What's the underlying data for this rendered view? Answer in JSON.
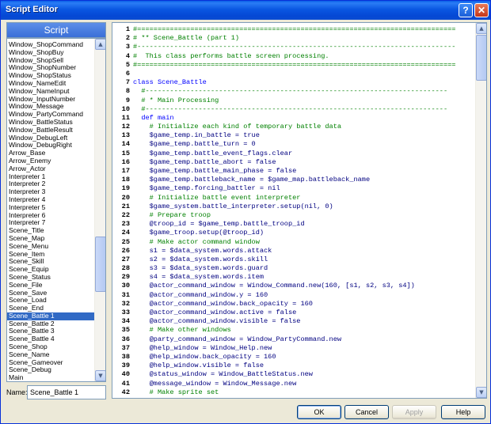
{
  "window": {
    "title": "Script Editor",
    "help_glyph": "?",
    "close_glyph": "✕"
  },
  "left": {
    "header": "Script",
    "items": [
      "Window_ShopCommand",
      "Window_ShopBuy",
      "Window_ShopSell",
      "Window_ShopNumber",
      "Window_ShopStatus",
      "Window_NameEdit",
      "Window_NameInput",
      "Window_InputNumber",
      "Window_Message",
      "Window_PartyCommand",
      "Window_BattleStatus",
      "Window_BattleResult",
      "Window_DebugLeft",
      "Window_DebugRight",
      "Arrow_Base",
      "Arrow_Enemy",
      "Arrow_Actor",
      "Interpreter 1",
      "Interpreter 2",
      "Interpreter 3",
      "Interpreter 4",
      "Interpreter 5",
      "Interpreter 6",
      "Interpreter 7",
      "Scene_Title",
      "Scene_Map",
      "Scene_Menu",
      "Scene_Item",
      "Scene_Skill",
      "Scene_Equip",
      "Scene_Status",
      "Scene_File",
      "Scene_Save",
      "Scene_Load",
      "Scene_End",
      "Scene_Battle 1",
      "Scene_Battle 2",
      "Scene_Battle 3",
      "Scene_Battle 4",
      "Scene_Shop",
      "Scene_Name",
      "Scene_Gameover",
      "Scene_Debug",
      "Main"
    ],
    "selected_index": 35,
    "name_label": "Name:",
    "name_value": "Scene_Battle 1"
  },
  "editor": {
    "lines": [
      {
        "n": "1",
        "t": "#==============================================================================",
        "k": "comment"
      },
      {
        "n": "2",
        "t": "# ** Scene_Battle (part 1)",
        "k": "comment"
      },
      {
        "n": "3",
        "t": "#------------------------------------------------------------------------------",
        "k": "comment"
      },
      {
        "n": "4",
        "t": "#  This class performs battle screen processing.",
        "k": "comment"
      },
      {
        "n": "5",
        "t": "#==============================================================================",
        "k": "comment"
      },
      {
        "n": "6",
        "t": "",
        "k": "normal"
      },
      {
        "n": "7",
        "t": "class Scene_Battle",
        "k": "keyword"
      },
      {
        "n": "8",
        "t": "  #--------------------------------------------------------------------------",
        "k": "comment"
      },
      {
        "n": "9",
        "t": "  # * Main Processing",
        "k": "comment"
      },
      {
        "n": "10",
        "t": "  #--------------------------------------------------------------------------",
        "k": "comment"
      },
      {
        "n": "11",
        "t": "  def main",
        "k": "keyword"
      },
      {
        "n": "12",
        "t": "    # Initialize each kind of temporary battle data",
        "k": "comment"
      },
      {
        "n": "13",
        "t": "    $game_temp.in_battle = true",
        "k": "normal"
      },
      {
        "n": "14",
        "t": "    $game_temp.battle_turn = 0",
        "k": "normal"
      },
      {
        "n": "15",
        "t": "    $game_temp.battle_event_flags.clear",
        "k": "normal"
      },
      {
        "n": "16",
        "t": "    $game_temp.battle_abort = false",
        "k": "normal"
      },
      {
        "n": "17",
        "t": "    $game_temp.battle_main_phase = false",
        "k": "normal"
      },
      {
        "n": "18",
        "t": "    $game_temp.battleback_name = $game_map.battleback_name",
        "k": "normal"
      },
      {
        "n": "19",
        "t": "    $game_temp.forcing_battler = nil",
        "k": "normal"
      },
      {
        "n": "20",
        "t": "    # Initialize battle event interpreter",
        "k": "comment"
      },
      {
        "n": "21",
        "t": "    $game_system.battle_interpreter.setup(nil, 0)",
        "k": "normal"
      },
      {
        "n": "22",
        "t": "    # Prepare troop",
        "k": "comment"
      },
      {
        "n": "23",
        "t": "    @troop_id = $game_temp.battle_troop_id",
        "k": "normal"
      },
      {
        "n": "24",
        "t": "    $game_troop.setup(@troop_id)",
        "k": "normal"
      },
      {
        "n": "25",
        "t": "    # Make actor command window",
        "k": "comment"
      },
      {
        "n": "26",
        "t": "    s1 = $data_system.words.attack",
        "k": "normal"
      },
      {
        "n": "27",
        "t": "    s2 = $data_system.words.skill",
        "k": "normal"
      },
      {
        "n": "28",
        "t": "    s3 = $data_system.words.guard",
        "k": "normal"
      },
      {
        "n": "29",
        "t": "    s4 = $data_system.words.item",
        "k": "normal"
      },
      {
        "n": "30",
        "t": "    @actor_command_window = Window_Command.new(160, [s1, s2, s3, s4])",
        "k": "normal"
      },
      {
        "n": "31",
        "t": "    @actor_command_window.y = 160",
        "k": "normal"
      },
      {
        "n": "32",
        "t": "    @actor_command_window.back_opacity = 160",
        "k": "normal"
      },
      {
        "n": "33",
        "t": "    @actor_command_window.active = false",
        "k": "normal"
      },
      {
        "n": "34",
        "t": "    @actor_command_window.visible = false",
        "k": "normal"
      },
      {
        "n": "35",
        "t": "    # Make other windows",
        "k": "comment"
      },
      {
        "n": "36",
        "t": "    @party_command_window = Window_PartyCommand.new",
        "k": "normal"
      },
      {
        "n": "37",
        "t": "    @help_window = Window_Help.new",
        "k": "normal"
      },
      {
        "n": "38",
        "t": "    @help_window.back_opacity = 160",
        "k": "normal"
      },
      {
        "n": "39",
        "t": "    @help_window.visible = false",
        "k": "normal"
      },
      {
        "n": "40",
        "t": "    @status_window = Window_BattleStatus.new",
        "k": "normal"
      },
      {
        "n": "41",
        "t": "    @message_window = Window_Message.new",
        "k": "normal"
      },
      {
        "n": "42",
        "t": "    # Make sprite set",
        "k": "comment"
      }
    ]
  },
  "buttons": {
    "ok": "OK",
    "cancel": "Cancel",
    "apply": "Apply",
    "help": "Help"
  },
  "colors": {
    "titlebar": "#0a57e2",
    "selection": "#316ac5",
    "comment": "#008000",
    "keyword": "#0000ff",
    "code": "#000080"
  }
}
